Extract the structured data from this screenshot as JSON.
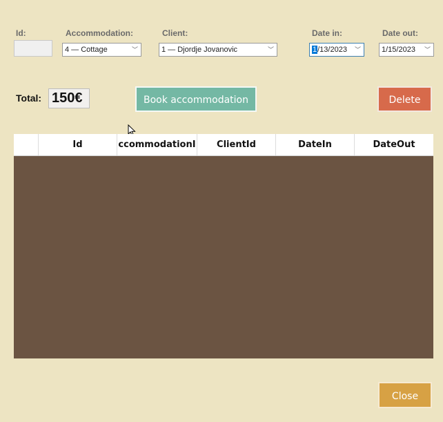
{
  "form": {
    "id_label": "Id:",
    "id_value": "",
    "accommodation_label": "Accommodation:",
    "accommodation_value": "4 — Cottage",
    "client_label": "Client:",
    "client_value": "1 — Djordje Jovanovic",
    "date_in_label": "Date in:",
    "date_in_selected": "1",
    "date_in_rest": "/13/2023",
    "date_out_label": "Date out:",
    "date_out_value": "1/15/2023"
  },
  "total": {
    "label": "Total:",
    "value": "150€"
  },
  "buttons": {
    "book": "Book accommodation",
    "delete": "Delete",
    "close": "Close"
  },
  "grid": {
    "columns": [
      "",
      "Id",
      "ccommodationI",
      "ClientId",
      "DateIn",
      "DateOut"
    ],
    "rows": []
  },
  "colors": {
    "background": "#ede4c2",
    "grid_body": "#6b5442",
    "book_button": "#74b8a4",
    "delete_button": "#d76a4b",
    "close_button": "#d7a144"
  },
  "icons": {
    "dropdown": "chevron-down-icon",
    "cursor": "mouse-pointer-icon"
  }
}
